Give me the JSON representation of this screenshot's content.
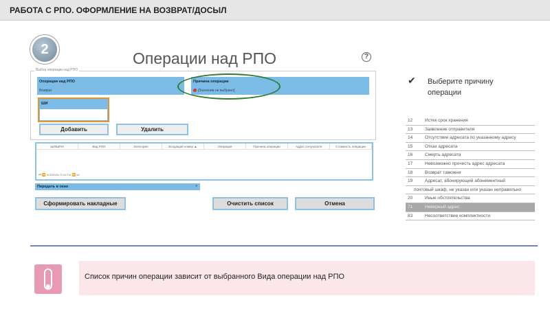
{
  "header": {
    "title": "РАБОТА С РПО. ОФОРМЛЕНИЕ НА ВОЗВРАТ/ДОСЫЛ"
  },
  "step": "2",
  "dialog": {
    "title": "Операции над РПО",
    "help": "?",
    "group_label": "Выбор операции над РПО",
    "operation_label": "Операция над РПО",
    "operation_value": "Возврат",
    "reason_label": "Причина операции",
    "reason_value": "[Значение не выбрано]",
    "shi_label": "ШИ",
    "add_button": "Добавить",
    "delete_button": "Удалить",
    "columns": [
      "ШИ/ШПИ",
      "Вид РПО",
      "Категория",
      "Входящий номер ▲",
      "Операция",
      "Причина операции",
      "Адрес получателя",
      "Стоимость операции"
    ],
    "pager": "⏮ ⏪ ◂ Запись 0 из 0 ▸ ⏩ ⏭",
    "transfer_select": "Передать в окно",
    "form_button": "Сформировать накладные",
    "clear_button": "Очистить список",
    "cancel_button": "Отмена"
  },
  "hint": {
    "line1": "Выберите причину",
    "line2": "операции"
  },
  "reasons": [
    {
      "n": "12",
      "t": "Истек срок хранения"
    },
    {
      "n": "13",
      "t": "Заявление отправителя"
    },
    {
      "n": "14",
      "t": "Отсутствие адресата по указанному адресу"
    },
    {
      "n": "15",
      "t": "Отказ адресата"
    },
    {
      "n": "16",
      "t": "Смерть адресата"
    },
    {
      "n": "17",
      "t": "Невозможно прочесть адрес адресата"
    },
    {
      "n": "18",
      "t": "Возврат таможни"
    },
    {
      "n": "19",
      "t": "Адресат, абонирующий абонементный"
    },
    {
      "n": "",
      "t": "почтовый шкаф, не указан или указан неправильно"
    },
    {
      "n": "20",
      "t": "Иные обстоятельства"
    },
    {
      "n": "71",
      "t": "Неверный адрес"
    },
    {
      "n": "83",
      "t": "Несоответствие комплектности"
    }
  ],
  "note": "Список причин операции зависит от выбранного Вида операции над РПО"
}
